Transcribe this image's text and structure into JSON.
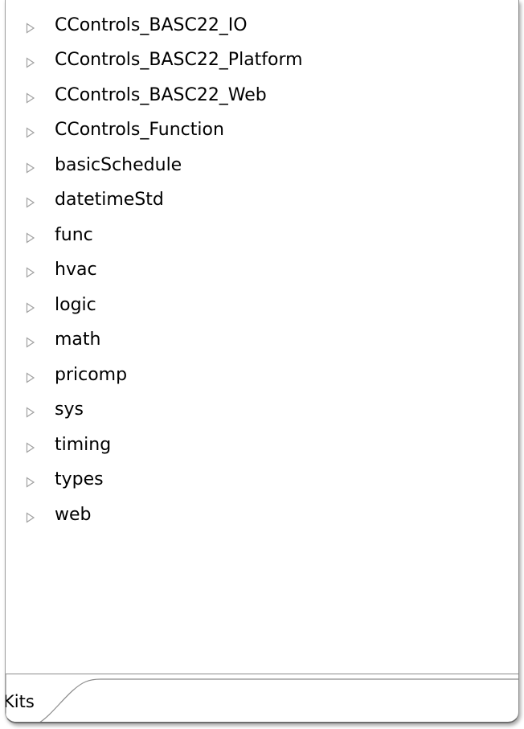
{
  "tree": {
    "items": [
      {
        "label": "CControls_BASC22_IO",
        "expander_icon": "triangle-right-outline"
      },
      {
        "label": "CControls_BASC22_Platform",
        "expander_icon": "triangle-right-outline"
      },
      {
        "label": "CControls_BASC22_Web",
        "expander_icon": "triangle-right-outline"
      },
      {
        "label": "CControls_Function",
        "expander_icon": "triangle-right-outline"
      },
      {
        "label": "basicSchedule",
        "expander_icon": "triangle-right-outline"
      },
      {
        "label": "datetimeStd",
        "expander_icon": "triangle-right-outline"
      },
      {
        "label": "func",
        "expander_icon": "triangle-right-outline"
      },
      {
        "label": "hvac",
        "expander_icon": "triangle-right-outline"
      },
      {
        "label": "logic",
        "expander_icon": "triangle-right-outline"
      },
      {
        "label": "math",
        "expander_icon": "triangle-right-outline"
      },
      {
        "label": "pricomp",
        "expander_icon": "triangle-right-outline"
      },
      {
        "label": "sys",
        "expander_icon": "triangle-right-outline"
      },
      {
        "label": "timing",
        "expander_icon": "triangle-right-outline"
      },
      {
        "label": "types",
        "expander_icon": "triangle-right-outline"
      },
      {
        "label": "web",
        "expander_icon": "triangle-right-outline"
      }
    ]
  },
  "tabs": {
    "active_label": "Kits"
  },
  "colors": {
    "expander": "#a0a0a0",
    "text": "#000000",
    "border": "#8c8c8c"
  }
}
